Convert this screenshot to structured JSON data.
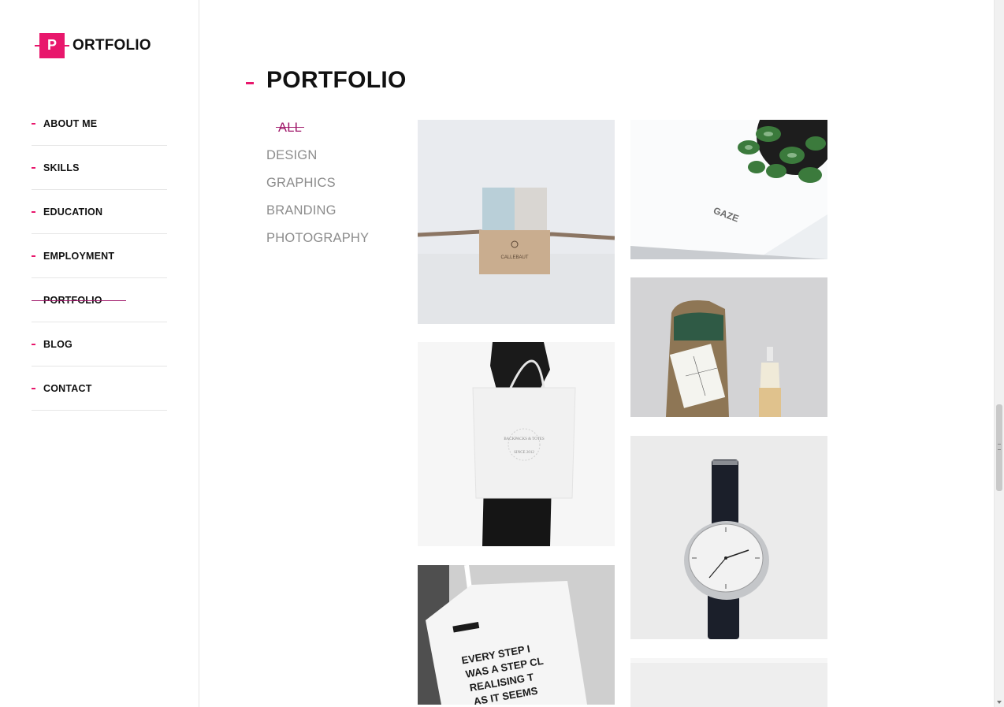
{
  "brand": {
    "logo_letter": "P",
    "logo_text": "ORTFOLIO",
    "accent": "#e8176c",
    "active_color": "#a0186a"
  },
  "nav": {
    "items": [
      {
        "label": "ABOUT ME"
      },
      {
        "label": "SKILLS"
      },
      {
        "label": "EDUCATION"
      },
      {
        "label": "EMPLOYMENT"
      },
      {
        "label": "PORTFOLIO",
        "active": true
      },
      {
        "label": "BLOG"
      },
      {
        "label": "CONTACT"
      }
    ]
  },
  "main": {
    "title": "PORTFOLIO",
    "filters": [
      {
        "label": "ALL",
        "active": true
      },
      {
        "label": "DESIGN"
      },
      {
        "label": "GRAPHICS"
      },
      {
        "label": "BRANDING"
      },
      {
        "label": "PHOTOGRAPHY"
      }
    ],
    "gallery": {
      "box_label": "CALLEBAUT",
      "card_label": "GAZE",
      "tote_text": "BACKPACKS & TOTES",
      "tote_since": "SINCE 2012",
      "bag_text": [
        "EVERY STEP I",
        "WAS A STEP CL",
        "REALISING T",
        "AS IT SEEMS"
      ]
    }
  }
}
